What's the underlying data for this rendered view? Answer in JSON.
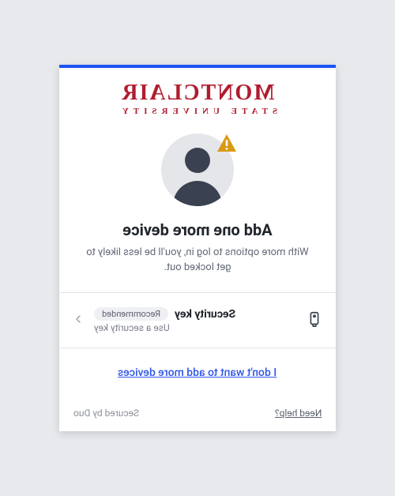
{
  "branding": {
    "name_main": "MONTCLAIR",
    "name_sub": "STATE UNIVERSITY",
    "brand_color": "#b01c2e",
    "accent_color": "#1c52f4"
  },
  "avatar": {
    "warning": true
  },
  "content": {
    "title": "Add one more device",
    "subtitle": "With more options to log in, you'll be less likely to get locked out."
  },
  "options": [
    {
      "icon": "security-key",
      "title": "Security key",
      "badge": "Recommended",
      "description": "Use a security key"
    }
  ],
  "skip": {
    "label": "I don't want to add more devices"
  },
  "footer": {
    "help_label": "Need help?",
    "secured_label": "Secured by Duo"
  }
}
